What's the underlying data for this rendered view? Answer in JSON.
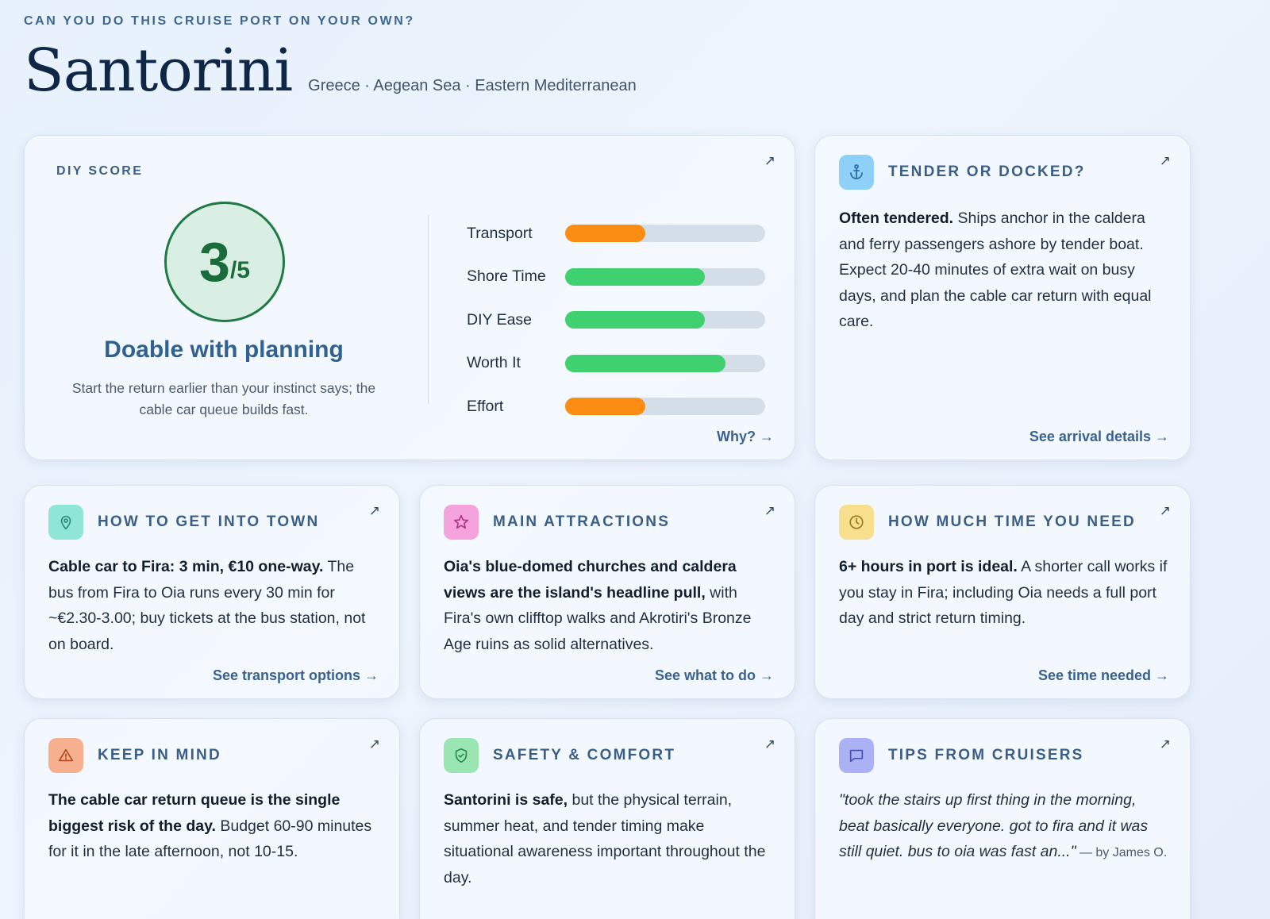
{
  "header": {
    "eyebrow": "CAN YOU DO THIS CRUISE PORT ON YOUR OWN?",
    "title": "Santorini",
    "subtitle": "Greece · Aegean Sea · Eastern Mediterranean"
  },
  "diy": {
    "label": "DIY SCORE",
    "score": "3",
    "score_max": "/5",
    "verdict": "Doable with planning",
    "note": "Start the return earlier than your instinct says; the cable car queue builds fast.",
    "metrics": [
      {
        "label": "Transport",
        "fraction": 0.4,
        "color": "#fb8c14"
      },
      {
        "label": "Shore Time",
        "fraction": 0.7,
        "color": "#3fd16f"
      },
      {
        "label": "DIY Ease",
        "fraction": 0.7,
        "color": "#3fd16f"
      },
      {
        "label": "Worth It",
        "fraction": 0.8,
        "color": "#3fd16f"
      },
      {
        "label": "Effort",
        "fraction": 0.4,
        "color": "#fb8c14"
      }
    ],
    "why_link": "Why? →",
    "corner_icon": "↗"
  },
  "cards": {
    "tender": {
      "heading": "TENDER OR DOCKED?",
      "icon": "anchor-icon",
      "bold": "Often tendered.",
      "text": " Ships anchor in the caldera and ferry passengers ashore by tender boat. Expect 20-40 minutes of extra wait on busy days, and plan the cable car return with equal care.",
      "link": "See arrival details →",
      "corner_icon": "↗"
    },
    "town": {
      "heading": "HOW TO GET INTO TOWN",
      "icon": "map-pin-icon",
      "bold": "Cable car to Fira: 3 min, €10 one-way.",
      "text": " The bus from Fira to Oia runs every 30 min for ~€2.30-3.00; buy tickets at the bus station, not on board.",
      "link": "See transport options →",
      "corner_icon": "↗"
    },
    "attractions": {
      "heading": "MAIN ATTRACTIONS",
      "icon": "star-icon",
      "bold": "Oia's blue-domed churches and caldera views are the island's headline pull,",
      "text": " with Fira's own clifftop walks and Akrotiri's Bronze Age ruins as solid alternatives.",
      "link": "See what to do →",
      "corner_icon": "↗"
    },
    "time": {
      "heading": "HOW MUCH TIME YOU NEED",
      "icon": "clock-icon",
      "bold": "6+ hours in port is ideal.",
      "text": " A shorter call works if you stay in Fira; including Oia needs a full port day and strict return timing.",
      "link": "See time needed →",
      "corner_icon": "↗"
    },
    "keep": {
      "heading": "KEEP IN MIND",
      "icon": "warning-icon",
      "bold": "The cable car return queue is the single biggest risk of the day.",
      "text": " Budget 60-90 minutes for it in the late afternoon, not 10-15.",
      "corner_icon": "↗"
    },
    "safety": {
      "heading": "SAFETY & COMFORT",
      "icon": "shield-check-icon",
      "bold": "Santorini is safe,",
      "text": " but the physical terrain, summer heat, and tender timing make situational awareness important throughout the day.",
      "corner_icon": "↗"
    },
    "tips": {
      "heading": "TIPS FROM CRUISERS",
      "icon": "chat-bubble-icon",
      "quote": "\"took the stairs up first thing in the morning, beat basically everyone. got to fira and it was still quiet. bus to oia was fast an...\"",
      "by": " — by James O.",
      "corner_icon": "↗"
    }
  }
}
